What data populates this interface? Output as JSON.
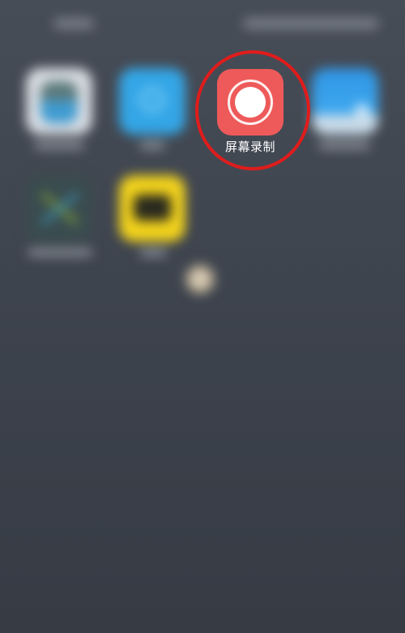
{
  "home_screen": {
    "focused_app": {
      "label": "屏幕录制",
      "icon": "record-icon",
      "color": "#ee5a5a"
    },
    "annotation": {
      "shape": "circle",
      "color": "#e01c1c"
    },
    "blurred_apps": [
      {
        "icon": "contact-avatar-icon",
        "color": "#d9dde3"
      },
      {
        "icon": "search-icon",
        "color": "#34a6e6"
      },
      {
        "icon": "cloud-icon",
        "color": "#2f95e5"
      },
      {
        "icon": "cross-tools-icon",
        "color": "#3a4c4f"
      },
      {
        "icon": "yellow-app-icon",
        "color": "#f2d21c"
      }
    ],
    "floating_button": {
      "icon": "assistive-touch-icon"
    }
  }
}
